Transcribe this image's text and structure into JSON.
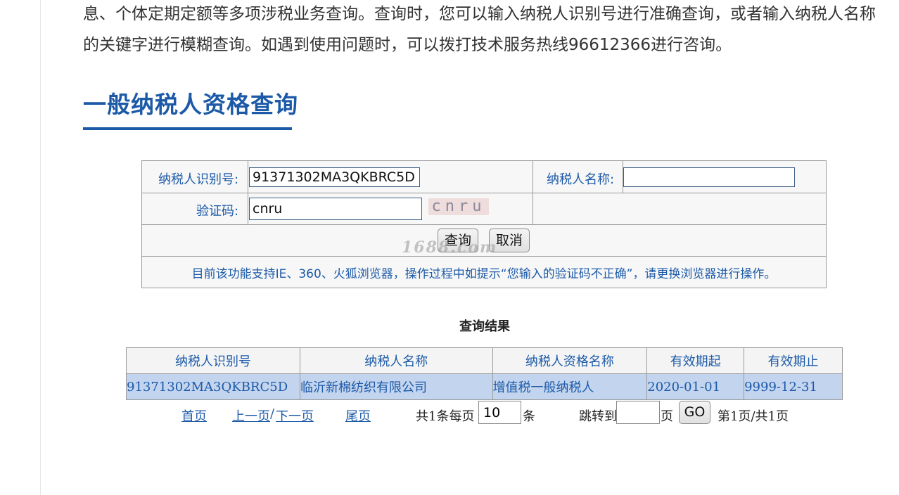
{
  "intro": {
    "text": "息、个体定期定额等多项涉税业务查询。查询时，您可以输入纳税人识别号进行准确查询，或者输入纳税人名称的关键字进行模糊查询。如遇到使用问题时，可以拨打技术服务热线96612366进行咨询。"
  },
  "section": {
    "title": "一般纳税人资格查询"
  },
  "form": {
    "taxpayer_id_label": "纳税人识别号:",
    "taxpayer_id_value": "91371302MA3QKBRC5D",
    "taxpayer_name_label": "纳税人名称:",
    "taxpayer_name_value": "",
    "captcha_label": "验证码:",
    "captcha_value": "cnru",
    "captcha_image_text": "cnru",
    "query_button": "查询",
    "cancel_button": "取消",
    "notice": "目前该功能支持IE、360、火狐浏览器，操作过程中如提示“您输入的验证码不正确”，请更换浏览器进行操作。"
  },
  "watermark": "1688.com",
  "results": {
    "title": "查询结果",
    "columns": [
      "纳税人识别号",
      "纳税人名称",
      "纳税人资格名称",
      "有效期起",
      "有效期止"
    ],
    "rows": [
      [
        "91371302MA3QKBRC5D",
        "临沂新棉纺织有限公司",
        "增值税一般纳税人",
        "2020-01-01",
        "9999-12-31"
      ]
    ]
  },
  "pager": {
    "first": "首页",
    "prev": "上一页",
    "sep": "/",
    "next": "下一页",
    "last": "尾页",
    "summary": "共1条每页",
    "page_size": "10",
    "unit": "条",
    "jump_label": "跳转到",
    "jump_value": "",
    "page_unit": "页",
    "go_button": "GO",
    "status": "第1页/共1页"
  },
  "colors": {
    "accent": "#1c5aa8",
    "row_bg": "#c3d4ee",
    "header_bg": "#f4f4f4"
  }
}
